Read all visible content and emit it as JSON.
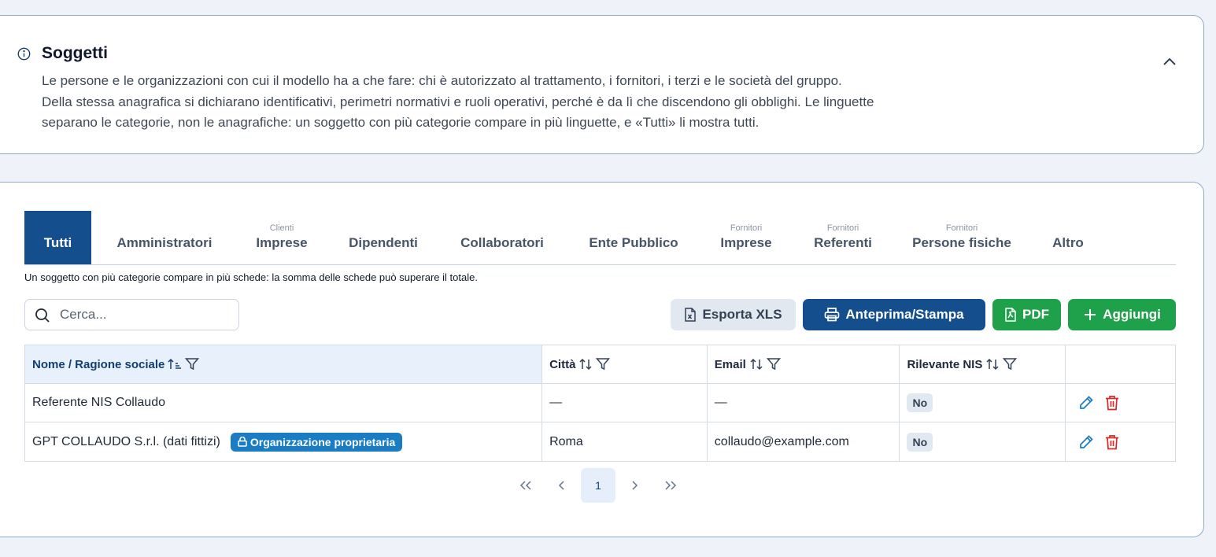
{
  "info": {
    "title": "Soggetti",
    "text": "Le persone e le organizzazioni con cui il modello ha a che fare: chi è autorizzato al trattamento, i fornitori, i terzi e le società del gruppo. Della stessa anagrafica si dichiarano identificativi, perimetri normativi e ruoli operativi, perché è da lì che discendono gli obblighi. Le linguette separano le categorie, non le anagrafiche: un soggetto con più categorie compare in più linguette, e «Tutti» li mostra tutti."
  },
  "tabs": [
    {
      "sub": "",
      "label": "Tutti",
      "active": true
    },
    {
      "sub": "",
      "label": "Amministratori"
    },
    {
      "sub": "Clienti",
      "label": "Imprese"
    },
    {
      "sub": "",
      "label": "Dipendenti"
    },
    {
      "sub": "",
      "label": "Collaboratori"
    },
    {
      "sub": "",
      "label": "Ente Pubblico"
    },
    {
      "sub": "Fornitori",
      "label": "Imprese"
    },
    {
      "sub": "Fornitori",
      "label": "Referenti"
    },
    {
      "sub": "Fornitori",
      "label": "Persone fisiche"
    },
    {
      "sub": "",
      "label": "Altro"
    }
  ],
  "note": "Un soggetto con più categorie compare in più schede: la somma delle schede può superare il totale.",
  "search": {
    "placeholder": "Cerca..."
  },
  "toolbar": {
    "xls": "Esporta XLS",
    "print": "Anteprima/Stampa",
    "pdf": "PDF",
    "add": "Aggiungi"
  },
  "table": {
    "headers": [
      "Nome / Ragione sociale",
      "Città",
      "Email",
      "Rilevante NIS"
    ],
    "rows": [
      {
        "name": "Referente NIS Collaudo",
        "badge": "",
        "city": "—",
        "email": "—",
        "nis": "No"
      },
      {
        "name": "GPT COLLAUDO S.r.l. (dati fittizi)",
        "badge": "Organizzazione proprietaria",
        "city": "Roma",
        "email": "collaudo@example.com",
        "nis": "No"
      }
    ]
  },
  "pagination": {
    "first": "«",
    "prev": "‹",
    "current": "1",
    "next": "›",
    "last": "»"
  },
  "colors": {
    "primary": "#144e8c",
    "success": "#1fa04a",
    "info_badge": "#1a7dc4",
    "danger": "#dc2626"
  }
}
